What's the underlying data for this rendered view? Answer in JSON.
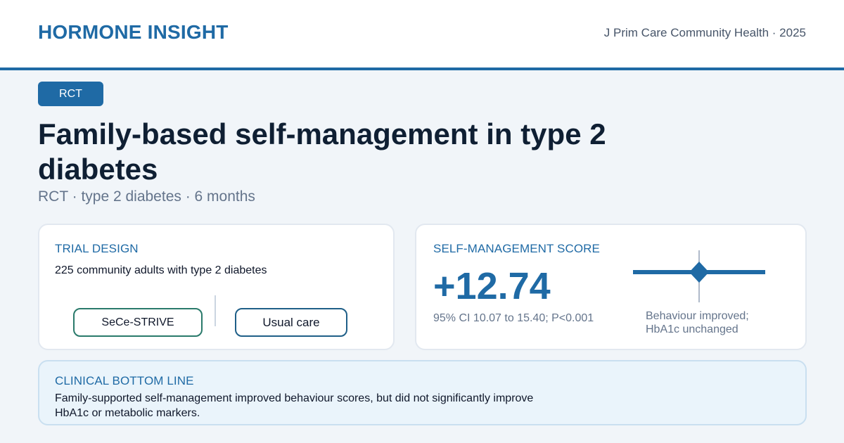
{
  "header": {
    "brand": "HORMONE INSIGHT",
    "journal": "J Prim Care Community Health · 2025"
  },
  "badge": "RCT",
  "title": "Family-based self-management in type 2 diabetes",
  "subtitle": "RCT · type 2 diabetes · 6 months",
  "design": {
    "label": "TRIAL DESIGN",
    "description": "225 community adults with type 2 diabetes",
    "arms": [
      "SeCe-STRIVE",
      "Usual care"
    ]
  },
  "score": {
    "label": "SELF-MANAGEMENT SCORE",
    "effect": "+12.74",
    "ci": "95% CI 10.07 to 15.40; P<0.001",
    "note_line1": "Behaviour improved;",
    "note_line2": "HbA1c unchanged"
  },
  "bottom": {
    "label": "CLINICAL BOTTOM LINE",
    "text": "Family-supported self-management improved behaviour scores, but did not significantly improve HbA1c or metabolic markers."
  },
  "colors": {
    "accent": "#1f6aa5",
    "intervention_border": "#2a7a6b",
    "control_border": "#1f5f88"
  }
}
